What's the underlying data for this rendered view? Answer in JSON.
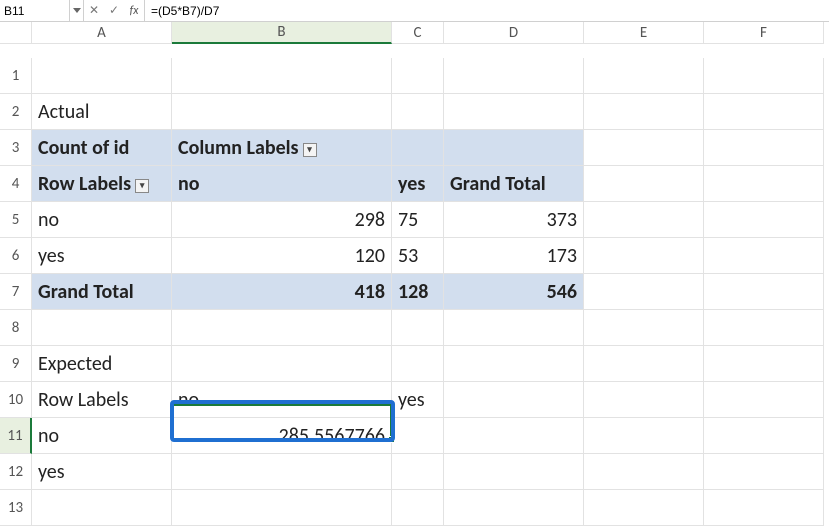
{
  "formula_bar": {
    "name_box": "B11",
    "formula": "=(D5*B7)/D7"
  },
  "columns": {
    "A": "A",
    "B": "B",
    "C": "C",
    "D": "D",
    "E": "E",
    "F": "F"
  },
  "rows": {
    "r1": "1",
    "r2": "2",
    "r3": "3",
    "r4": "4",
    "r5": "5",
    "r6": "6",
    "r7": "7",
    "r8": "8",
    "r9": "9",
    "r10": "10",
    "r11": "11",
    "r12": "12",
    "r13": "13"
  },
  "cells": {
    "A2": "Actual",
    "A3": "Count of id",
    "B3": "Column Labels",
    "A4": "Row Labels",
    "B4": "no",
    "C4": "yes",
    "D4": "Grand Total",
    "A5": "no",
    "B5": "298",
    "C5": "75",
    "D5": "373",
    "A6": "yes",
    "B6": "120",
    "C6": "53",
    "D6": "173",
    "A7": "Grand Total",
    "B7": "418",
    "C7": "128",
    "D7": "546",
    "A9": "Expected",
    "A10": "Row Labels",
    "B10": "no",
    "C10": "yes",
    "A11": "no",
    "B11": "285.5567766",
    "A12": "yes"
  },
  "dropdown_glyph": "▾"
}
